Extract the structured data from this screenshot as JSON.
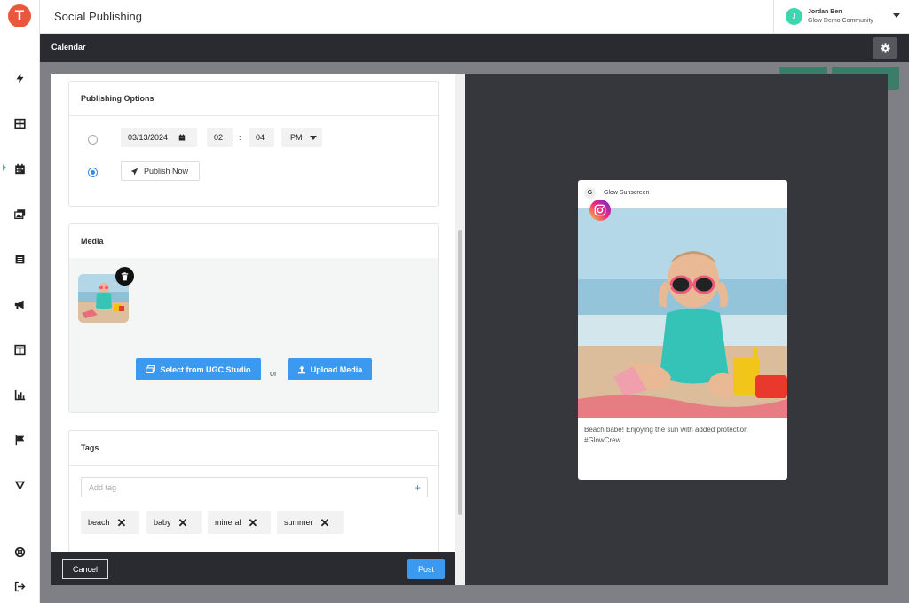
{
  "app": {
    "logo_letter": "T",
    "title": "Social Publishing"
  },
  "user": {
    "initial": "J",
    "name": "Jordan Ben",
    "community": "Glow Demo Community"
  },
  "nav": {
    "icons": [
      "bolt-icon",
      "grid-icon",
      "calendar-icon",
      "gallery-icon",
      "list-icon",
      "megaphone-icon",
      "layout-icon",
      "chart-icon",
      "flag-icon",
      "v-logo-icon",
      "lifebuoy-icon",
      "logout-icon"
    ],
    "active": "calendar-icon"
  },
  "page": {
    "section_title": "Calendar"
  },
  "publishing_options": {
    "title": "Publishing Options",
    "date": "03/13/2024",
    "hour": "02",
    "time_separator": ":",
    "minute": "04",
    "ampm": "PM",
    "publish_now_label": "Publish Now",
    "selected": "publish-now"
  },
  "media": {
    "title": "Media",
    "select_label": "Select from UGC Studio",
    "or_label": "or",
    "upload_label": "Upload Media"
  },
  "tags": {
    "title": "Tags",
    "placeholder": "Add tag",
    "add_symbol": "+",
    "items": [
      {
        "label": "beach"
      },
      {
        "label": "baby"
      },
      {
        "label": "mineral"
      },
      {
        "label": "summer"
      }
    ],
    "remove_symbol": "✕"
  },
  "footer": {
    "cancel_label": "Cancel",
    "post_label": "Post"
  },
  "preview": {
    "account_initial": "G",
    "account_name": "Glow Sunscreen",
    "caption": "Beach babe! Enjoying the sun with added protection #GlowCrew"
  },
  "colors": {
    "accent": "#3b9af0",
    "dark": "#2a2b30",
    "logo": "#e9573f",
    "avatar": "#3dd6b0"
  }
}
